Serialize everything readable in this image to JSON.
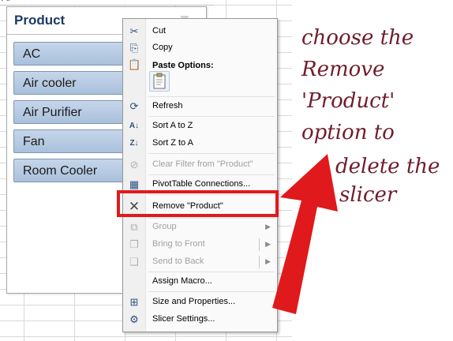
{
  "sheet": {
    "top_text": "Al"
  },
  "slicer": {
    "title": "Product",
    "items": [
      "AC",
      "Air cooler",
      "Air Purifier",
      "Fan",
      "Room Cooler"
    ]
  },
  "menu": {
    "cut": "Cut",
    "copy": "Copy",
    "paste_options": "Paste Options:",
    "refresh": "Refresh",
    "sort_a_z": "Sort A to Z",
    "sort_z_a": "Sort Z to A",
    "clear_filter": "Clear Filter from \"Product\"",
    "pivot_connections": "PivotTable Connections...",
    "remove": "Remove \"Product\"",
    "group": "Group",
    "bring_front": "Bring to Front",
    "send_back": "Send to Back",
    "assign_macro": "Assign Macro...",
    "size_props": "Size and Properties...",
    "slicer_settings": "Slicer Settings..."
  },
  "annotation": {
    "line1": "choose the",
    "line2": "Remove",
    "line3": "'Product'",
    "line4": "option to",
    "line5": "delete the",
    "line6": "slicer"
  },
  "colors": {
    "highlight": "#e0191c",
    "annotation": "#6f1d2c",
    "slicer_item": "#b8cbe3"
  }
}
